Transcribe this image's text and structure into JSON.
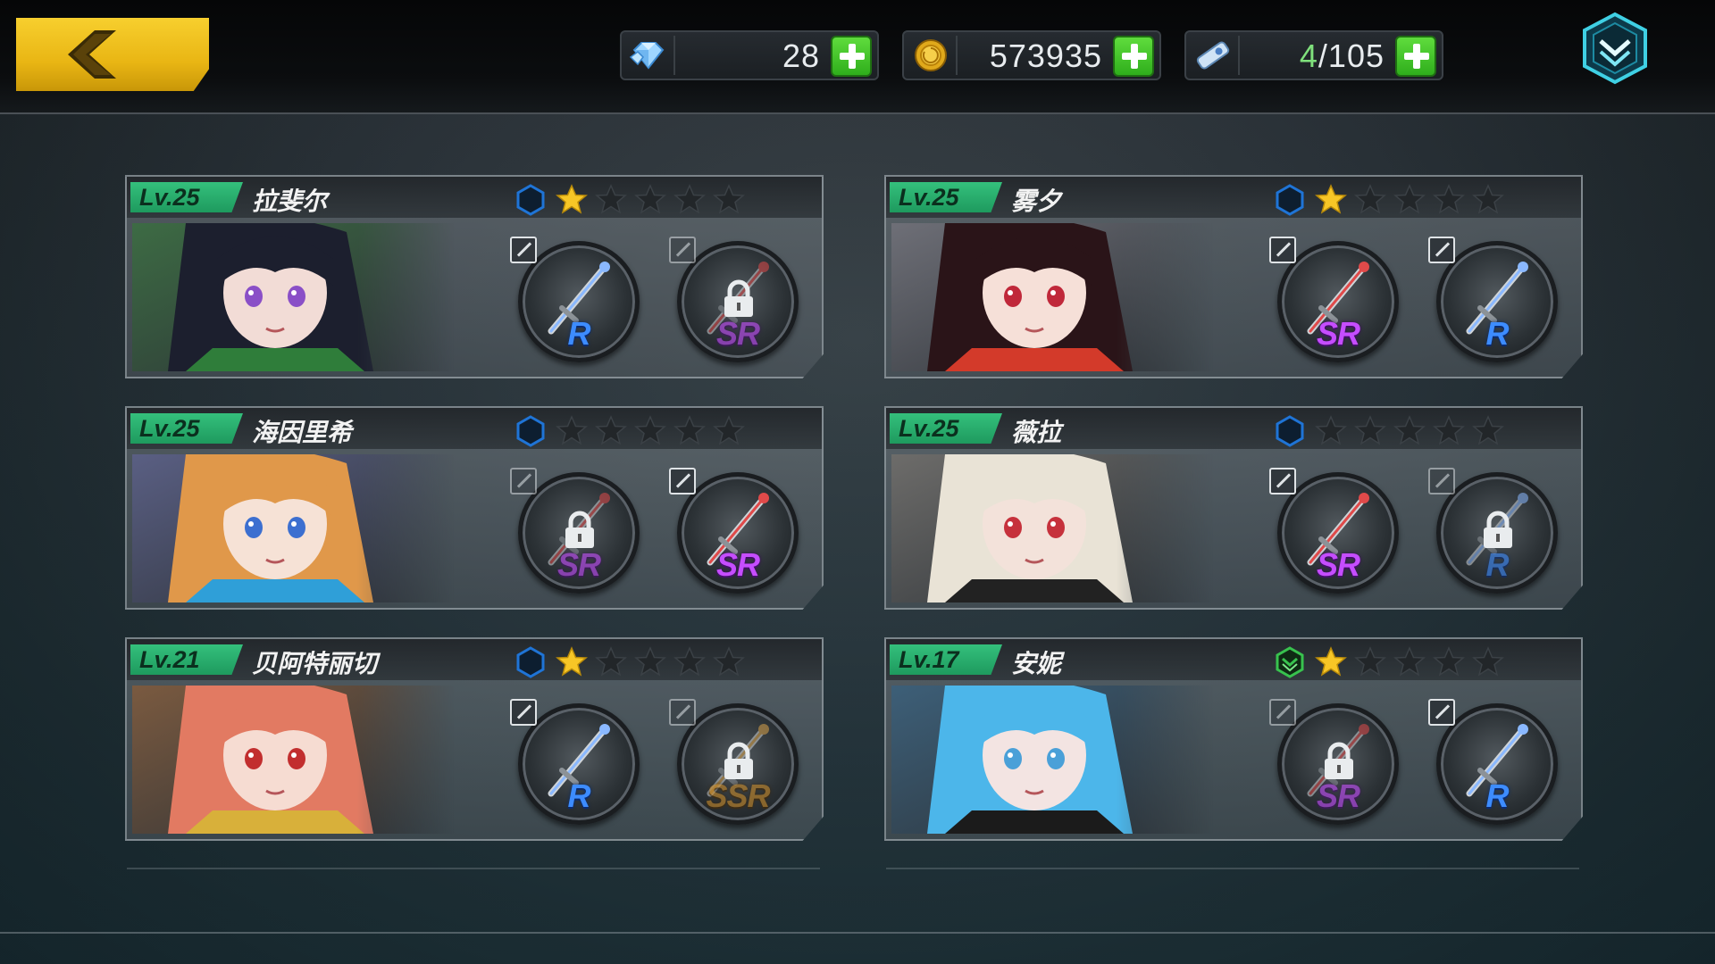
{
  "currency": {
    "gems": "28",
    "gold": "573935",
    "stamina_current": "4",
    "stamina_separator": "/105"
  },
  "icons": {
    "back": "back-arrow-icon",
    "gems": "diamond-icon",
    "gold": "gold-coin-icon",
    "stamina": "ticket-icon",
    "add": "plus-icon",
    "menu": "chevron-down-icon",
    "edit": "edit-icon",
    "lock": "lock-icon",
    "star": "star-icon",
    "rank": "hexagon-rank-icon"
  },
  "colors": {
    "level_badge": "#2bb071",
    "gold_star": "#f7c626",
    "empty_star": "#222629",
    "rank_blue": "#1f74d6",
    "rank_green": "#38c24e",
    "rarity_r": "#3d8cff",
    "rarity_sr": "#c64dff",
    "rarity_ssr": "#c98b2a",
    "back_button": "#f1c21d"
  },
  "characters": [
    {
      "level": "Lv.25",
      "name": "拉斐尔",
      "rank": "blue",
      "stars": 1,
      "weapons": [
        {
          "rarity": "R",
          "locked": false,
          "art": "twin-blades"
        },
        {
          "rarity": "SR",
          "locked": true,
          "art": "chain-blade"
        }
      ]
    },
    {
      "level": "Lv.25",
      "name": "雾夕",
      "rank": "blue",
      "stars": 1,
      "weapons": [
        {
          "rarity": "SR",
          "locked": false,
          "art": "red-fan"
        },
        {
          "rarity": "R",
          "locked": false,
          "art": "staff"
        }
      ]
    },
    {
      "level": "Lv.25",
      "name": "海因里希",
      "rank": "blue",
      "stars": 0,
      "weapons": [
        {
          "rarity": "SR",
          "locked": true,
          "art": "dark-gun"
        },
        {
          "rarity": "SR",
          "locked": false,
          "art": "red-blades"
        }
      ]
    },
    {
      "level": "Lv.25",
      "name": "薇拉",
      "rank": "blue",
      "stars": 0,
      "weapons": [
        {
          "rarity": "SR",
          "locked": false,
          "art": "death-box"
        },
        {
          "rarity": "R",
          "locked": true,
          "art": "black-gun"
        }
      ]
    },
    {
      "level": "Lv.21",
      "name": "贝阿特丽切",
      "rank": "blue",
      "stars": 1,
      "weapons": [
        {
          "rarity": "R",
          "locked": false,
          "art": "rapier"
        },
        {
          "rarity": "SSR",
          "locked": true,
          "art": "great-sword"
        }
      ]
    },
    {
      "level": "Lv.17",
      "name": "安妮",
      "rank": "green",
      "stars": 1,
      "weapons": [
        {
          "rarity": "SR",
          "locked": true,
          "art": "cannon"
        },
        {
          "rarity": "R",
          "locked": false,
          "art": "paw-staff"
        }
      ]
    }
  ]
}
